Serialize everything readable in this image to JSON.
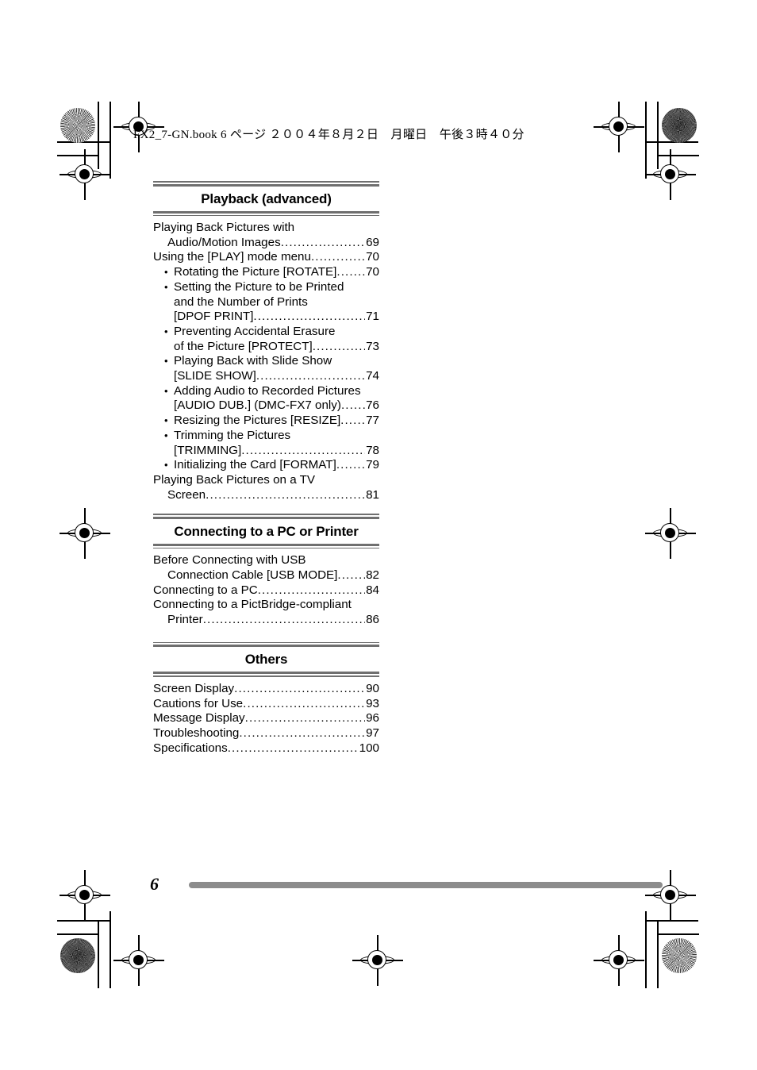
{
  "page": {
    "slug_line": "FX2_7-GN.book  6 ページ  ２００４年８月２日　月曜日　午後３時４０分",
    "folio": "6"
  },
  "sections": [
    {
      "title": "Playback (advanced)",
      "entries": [
        {
          "level": 0,
          "bullet": "",
          "label": "Playing Back Pictures with",
          "page": "",
          "leader": false
        },
        {
          "level": "0c",
          "bullet": "",
          "label": "Audio/Motion Images",
          "page": "69",
          "leader": true
        },
        {
          "level": 0,
          "bullet": "",
          "label": "Using the [PLAY] mode menu",
          "page": "70",
          "leader": true
        },
        {
          "level": 1,
          "bullet": "•",
          "label": "Rotating the Picture [ROTATE]",
          "page": "70",
          "leader": true
        },
        {
          "level": 1,
          "bullet": "•",
          "label": "Setting the Picture to be Printed",
          "page": "",
          "leader": false
        },
        {
          "level": "1c",
          "bullet": "",
          "label": "and the Number of Prints",
          "page": "",
          "leader": false
        },
        {
          "level": "1c",
          "bullet": "",
          "label": "[DPOF PRINT]",
          "page": "71",
          "leader": true
        },
        {
          "level": 1,
          "bullet": "•",
          "label": "Preventing Accidental Erasure",
          "page": "",
          "leader": false
        },
        {
          "level": "1c",
          "bullet": "",
          "label": "of the Picture [PROTECT]",
          "page": "73",
          "leader": true
        },
        {
          "level": 1,
          "bullet": "•",
          "label": "Playing Back with Slide Show",
          "page": "",
          "leader": false
        },
        {
          "level": "1c",
          "bullet": "",
          "label": "[SLIDE SHOW]",
          "page": "74",
          "leader": true
        },
        {
          "level": 1,
          "bullet": "•",
          "label": "Adding Audio to Recorded Pictures",
          "page": "",
          "leader": false
        },
        {
          "level": "1c",
          "bullet": "",
          "label": "[AUDIO DUB.] (DMC-FX7 only)",
          "page": "76",
          "leader": true
        },
        {
          "level": 1,
          "bullet": "•",
          "label": "Resizing the Pictures [RESIZE]",
          "page": "77",
          "leader": true
        },
        {
          "level": 1,
          "bullet": "•",
          "label": "Trimming the Pictures",
          "page": "",
          "leader": false
        },
        {
          "level": "1c",
          "bullet": "",
          "label": "[TRIMMING]",
          "page": "78",
          "leader": true
        },
        {
          "level": 1,
          "bullet": "•",
          "label": "Initializing the Card [FORMAT]",
          "page": "79",
          "leader": true
        },
        {
          "level": 0,
          "bullet": "",
          "label": "Playing Back Pictures on a TV",
          "page": "",
          "leader": false
        },
        {
          "level": "0c",
          "bullet": "",
          "label": "Screen",
          "page": "81",
          "leader": true
        }
      ]
    },
    {
      "title": "Connecting to a PC or Printer",
      "entries": [
        {
          "level": 0,
          "bullet": "",
          "label": "Before Connecting with USB",
          "page": "",
          "leader": false
        },
        {
          "level": "0c",
          "bullet": "",
          "label": "Connection Cable [USB MODE]",
          "page": "82",
          "leader": true
        },
        {
          "level": 0,
          "bullet": "",
          "label": "Connecting to a PC",
          "page": "84",
          "leader": true
        },
        {
          "level": 0,
          "bullet": "",
          "label": "Connecting to a PictBridge-compliant",
          "page": "",
          "leader": false
        },
        {
          "level": "0c",
          "bullet": "",
          "label": "Printer",
          "page": "86",
          "leader": true
        }
      ]
    },
    {
      "title": "Others",
      "entries": [
        {
          "level": 0,
          "bullet": "",
          "label": "Screen Display",
          "page": "90",
          "leader": true
        },
        {
          "level": 0,
          "bullet": "",
          "label": "Cautions for Use",
          "page": "93",
          "leader": true
        },
        {
          "level": 0,
          "bullet": "",
          "label": "Message Display",
          "page": "96",
          "leader": true
        },
        {
          "level": 0,
          "bullet": "",
          "label": "Troubleshooting",
          "page": "97",
          "leader": true
        },
        {
          "level": 0,
          "bullet": "",
          "label": "Specifications",
          "page": "100",
          "leader": true
        }
      ]
    }
  ],
  "colors": {
    "rule": "#6f6f6f",
    "footer_bar": "#8c8c8c",
    "text": "#000000"
  }
}
